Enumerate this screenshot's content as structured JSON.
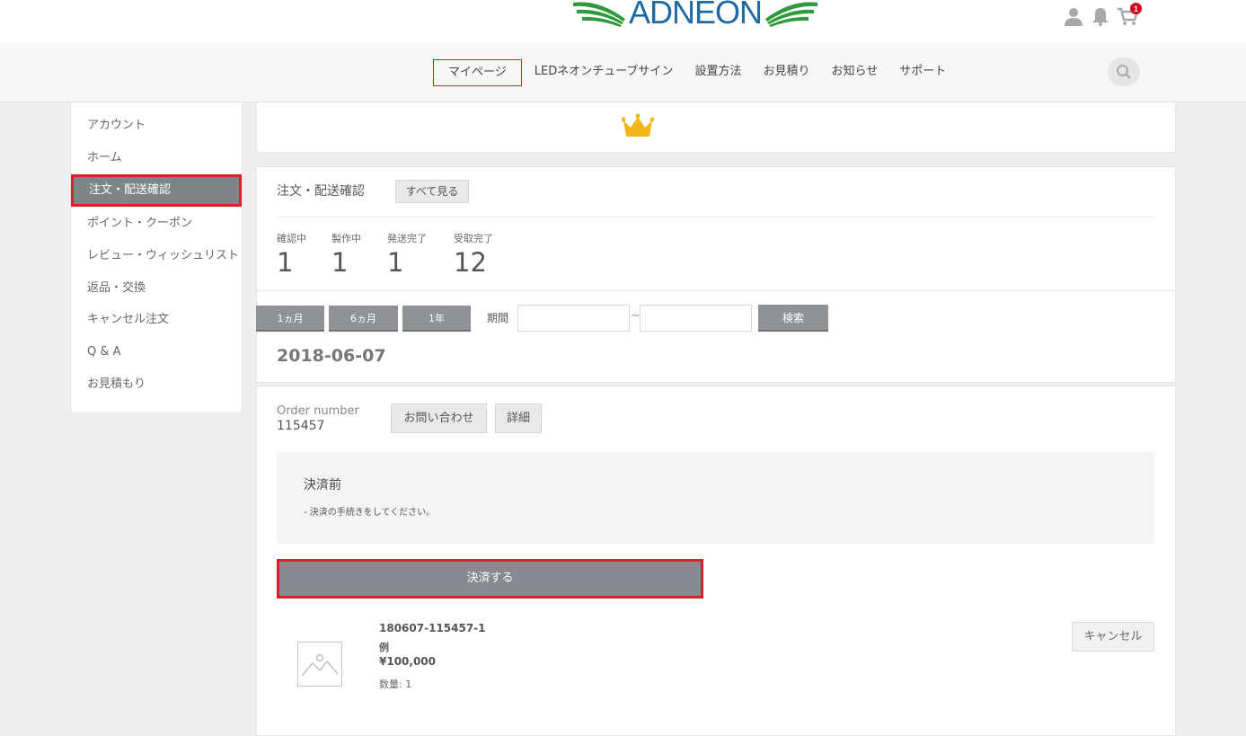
{
  "header": {
    "logo_text": "ADNEON",
    "cart_count": "1",
    "icons": [
      "user-icon",
      "bell-icon",
      "cart-icon"
    ]
  },
  "nav": {
    "items": [
      "マイページ",
      "LEDネオンチューブサイン",
      "設置方法",
      "お見積り",
      "お知らせ",
      "サポート"
    ],
    "active_index": 0
  },
  "sidebar": {
    "items": [
      "アカウント",
      "ホーム",
      "注文・配送確認",
      "ポイント・クーポン",
      "レビュー・ウィッシュリスト",
      "返品・交換",
      "キャンセル注文",
      "Q & A",
      "お見積もり"
    ],
    "active_index": 2
  },
  "orders": {
    "title": "注文・配送確認",
    "view_all": "すべて見る",
    "stats": [
      {
        "label": "確認中",
        "value": "1"
      },
      {
        "label": "製作中",
        "value": "1"
      },
      {
        "label": "発送完了",
        "value": "1"
      },
      {
        "label": "受取完了",
        "value": "12"
      }
    ]
  },
  "filter": {
    "periods": [
      "1ヵ月",
      "6ヵ月",
      "1年"
    ],
    "period_label": "期間",
    "separator": "~",
    "search": "検索"
  },
  "date_heading": "2018-06-07",
  "order": {
    "number_label": "Order number",
    "number": "115457",
    "contact": "お問い合わせ",
    "detail": "詳細",
    "status_title": "決済前",
    "status_note": "- 決済の手続きをしてください。",
    "pay_button": "決済する",
    "item": {
      "code": "180607-115457-1",
      "name": "例",
      "price": "¥100,000",
      "qty": "数量: 1"
    },
    "cancel": "キャンセル"
  },
  "colors": {
    "highlight": "#d8202a",
    "button_gray": "#8f9297",
    "logo_blue": "#1f6aa5",
    "logo_green": "#2e9a3c",
    "crown": "#f2b61c"
  }
}
